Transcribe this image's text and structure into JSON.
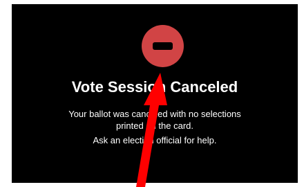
{
  "dialog": {
    "icon": "cancel-circle-icon",
    "title": "Vote Session Canceled",
    "message_line1": "Your ballot was canceled with no selections",
    "message_line2": "printed on the card.",
    "help": "Ask an election official for help."
  },
  "annotation": {
    "icon": "red-arrow-pointer"
  },
  "colors": {
    "background": "#000000",
    "text": "#ffffff",
    "icon_fill": "#d14445",
    "arrow": "#ff0000"
  }
}
